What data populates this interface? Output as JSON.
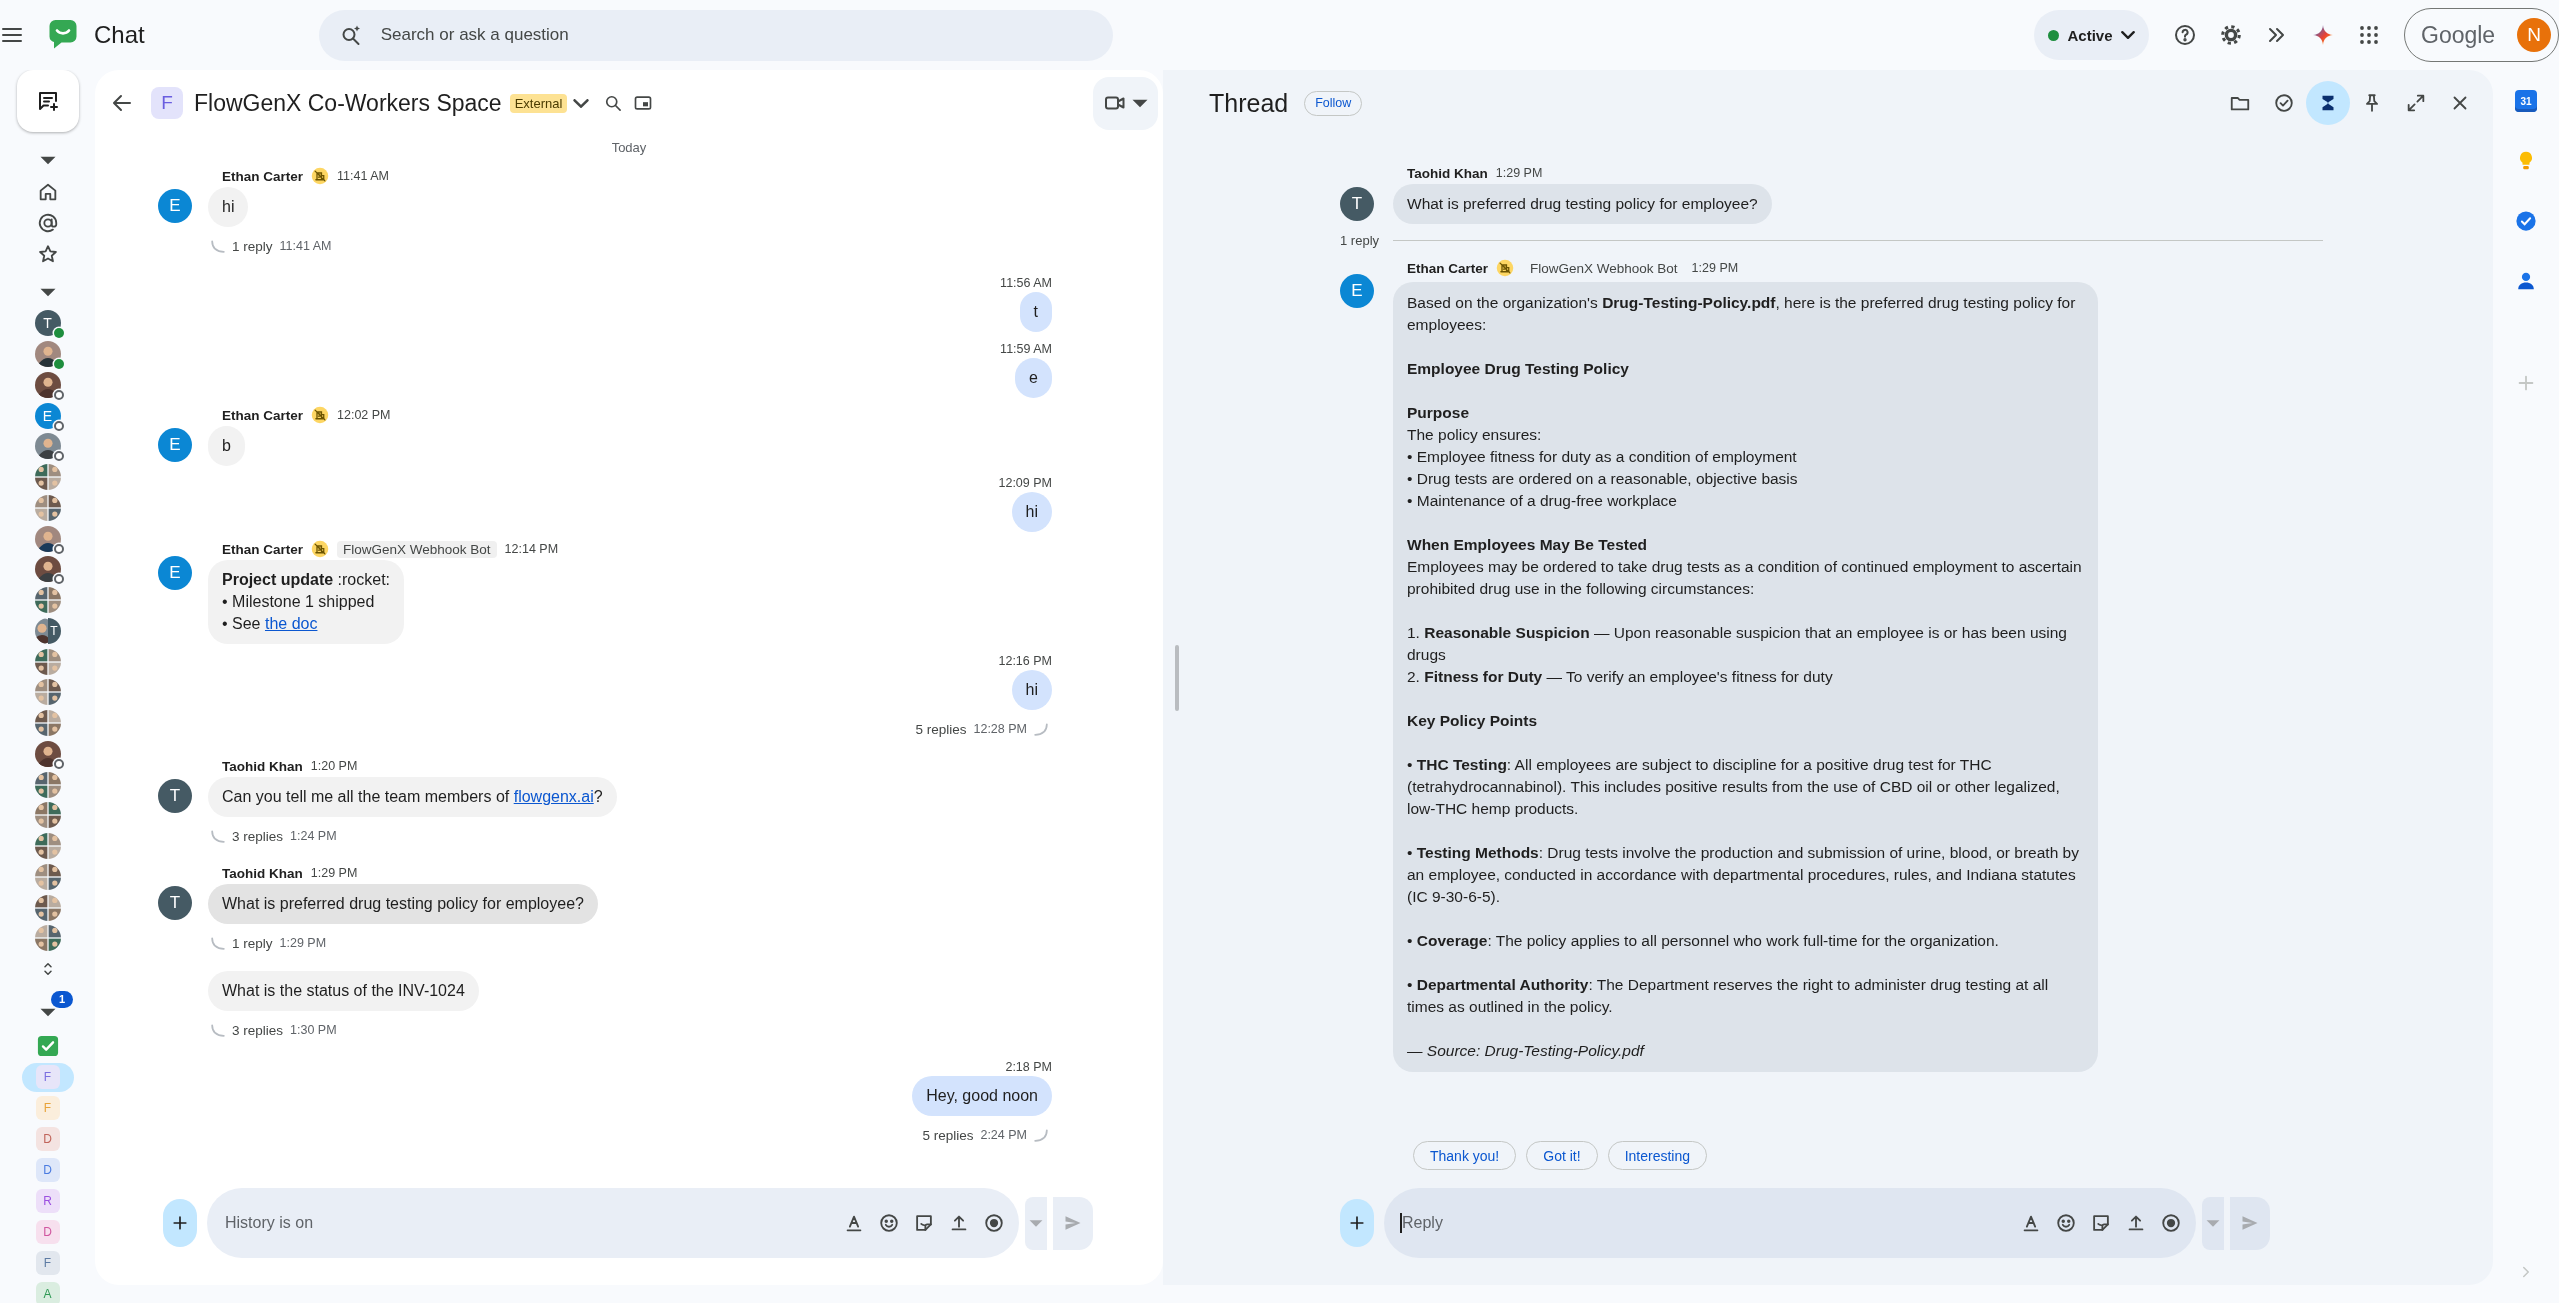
{
  "topbar": {
    "app_title": "Chat",
    "search": {
      "placeholder": "Search or ask a question"
    },
    "status": {
      "label": "Active",
      "available": true
    },
    "account": {
      "brand": "Google",
      "initial": "N"
    }
  },
  "rail": {
    "direct_messages": [
      {
        "kind": "letter",
        "initial": "T",
        "color": "#455a64",
        "online": true
      },
      {
        "kind": "photo",
        "online": true
      },
      {
        "kind": "photo",
        "online": false
      },
      {
        "kind": "letter",
        "initial": "E",
        "color": "#0b87d4",
        "online": false
      },
      {
        "kind": "photo",
        "online": false
      },
      {
        "kind": "group"
      },
      {
        "kind": "group"
      },
      {
        "kind": "photo",
        "online": false
      },
      {
        "kind": "photo",
        "online": false
      },
      {
        "kind": "group"
      },
      {
        "kind": "split",
        "initial": "T",
        "color": "#455a64"
      },
      {
        "kind": "group"
      },
      {
        "kind": "group"
      },
      {
        "kind": "group"
      },
      {
        "kind": "photo",
        "online": false
      },
      {
        "kind": "group"
      },
      {
        "kind": "group"
      },
      {
        "kind": "group"
      },
      {
        "kind": "group"
      },
      {
        "kind": "group"
      },
      {
        "kind": "group"
      }
    ],
    "spaces_badge": "1",
    "spaces": [
      {
        "kind": "check",
        "selected": false
      },
      {
        "kind": "letter",
        "initial": "F",
        "color": "#7b6fe0",
        "selected": true
      },
      {
        "kind": "letter",
        "initial": "F",
        "color": "#e8a33a",
        "selected": false
      },
      {
        "kind": "letter",
        "initial": "D",
        "color": "#c0645a",
        "selected": false
      },
      {
        "kind": "letter",
        "initial": "D",
        "color": "#4a7be0",
        "selected": false
      },
      {
        "kind": "letter",
        "initial": "R",
        "color": "#9b4fe0",
        "selected": false
      },
      {
        "kind": "letter",
        "initial": "D",
        "color": "#d0559f",
        "selected": false
      },
      {
        "kind": "letter",
        "initial": "F",
        "color": "#5d7ba3",
        "selected": false
      },
      {
        "kind": "letter",
        "initial": "A",
        "color": "#2f9a55",
        "selected": false
      }
    ]
  },
  "chat": {
    "header": {
      "initial": "F",
      "title": "FlowGenX Co-Workers Space",
      "badge": "External"
    },
    "date_label": "Today",
    "messages": [
      {
        "outgoing": false,
        "avatar": {
          "initial": "E",
          "color": "#0b87d4"
        },
        "sender": "Ethan Carter",
        "external_user": true,
        "time": "11:41 AM",
        "lines": [
          {
            "text": "hi"
          }
        ],
        "selected": false,
        "replies": "1 reply",
        "reply_time": "11:41 AM"
      },
      {
        "outgoing": true,
        "time": "11:56 AM",
        "lines": [
          {
            "text": "t"
          }
        ],
        "selected": false
      },
      {
        "outgoing": true,
        "time": "11:59 AM",
        "lines": [
          {
            "text": "e"
          }
        ],
        "selected": false
      },
      {
        "outgoing": false,
        "avatar": {
          "initial": "E",
          "color": "#0b87d4"
        },
        "sender": "Ethan Carter",
        "external_user": true,
        "time": "12:02 PM",
        "lines": [
          {
            "text": "b"
          }
        ],
        "selected": false
      },
      {
        "outgoing": true,
        "time": "12:09 PM",
        "lines": [
          {
            "text": "hi"
          }
        ],
        "selected": false
      },
      {
        "outgoing": false,
        "avatar": {
          "initial": "E",
          "color": "#0b87d4"
        },
        "sender": "Ethan Carter",
        "external_user": true,
        "bot_tag": "FlowGenX Webhook Bot",
        "time": "12:14 PM",
        "lines": [
          {
            "text": "**Project update** :rocket:"
          },
          {
            "text": "•  Milestone 1 shipped"
          },
          {
            "text": "•  See ",
            "link": "the doc"
          }
        ],
        "selected": false
      },
      {
        "outgoing": true,
        "time": "12:16 PM",
        "lines": [
          {
            "text": "hi"
          }
        ],
        "selected": false,
        "replies": "5 replies",
        "reply_time": "12:28 PM"
      },
      {
        "outgoing": false,
        "avatar": {
          "initial": "T",
          "color": "#455a64"
        },
        "sender": "Taohid Khan",
        "external_user": false,
        "time": "1:20 PM",
        "lines": [
          {
            "text": "Can you tell me all the team members of ",
            "link": "flowgenx.ai",
            "after": "?"
          }
        ],
        "selected": false,
        "replies": "3 replies",
        "reply_time": "1:24 PM"
      },
      {
        "outgoing": false,
        "avatar": {
          "initial": "T",
          "color": "#455a64"
        },
        "sender": "Taohid Khan",
        "external_user": false,
        "time": "1:29 PM",
        "lines": [
          {
            "text": "What is preferred drug testing policy for employee?"
          }
        ],
        "selected": true,
        "replies": "1 reply",
        "reply_time": "1:29 PM"
      },
      {
        "outgoing": false,
        "lines": [
          {
            "text": "What is the status of the INV-1024"
          }
        ],
        "selected": false,
        "replies": "3 replies",
        "reply_time": "1:30 PM"
      },
      {
        "outgoing": true,
        "time": "2:18 PM",
        "lines": [
          {
            "text": "Hey, good noon"
          }
        ],
        "selected": false,
        "replies": "5 replies",
        "reply_time": "2:24 PM"
      }
    ],
    "composer": {
      "placeholder": "History is on",
      "focused": false
    }
  },
  "thread": {
    "title": "Thread",
    "follow": "Follow",
    "tools": [
      {
        "kind": "files",
        "selected": false
      },
      {
        "kind": "tasks",
        "selected": false
      },
      {
        "kind": "summary",
        "selected": true
      },
      {
        "kind": "pin",
        "selected": false
      },
      {
        "kind": "expand",
        "selected": false
      },
      {
        "kind": "close",
        "selected": false
      }
    ],
    "root": {
      "avatar": {
        "initial": "T",
        "color": "#455a64"
      },
      "sender": "Taohid Khan",
      "time": "1:29 PM",
      "text": "What is preferred drug testing policy for employee?"
    },
    "reply_count": "1 reply",
    "answer": {
      "avatar": {
        "initial": "E",
        "color": "#0b87d4"
      },
      "sender": "Ethan Carter",
      "external_user": true,
      "bot_tag": "FlowGenX Webhook Bot",
      "time": "1:29 PM",
      "lines": [
        {
          "kind": "text",
          "text": "Based on the organization's **Drug-Testing-Policy.pdf**, here is the preferred drug testing policy for employees:"
        },
        {
          "kind": "gap"
        },
        {
          "kind": "heading",
          "text": "Employee Drug Testing Policy"
        },
        {
          "kind": "gap"
        },
        {
          "kind": "heading",
          "text": "Purpose"
        },
        {
          "kind": "text",
          "text": "The policy ensures:"
        },
        {
          "kind": "text",
          "text": "•  Employee fitness for duty as a condition of employment"
        },
        {
          "kind": "text",
          "text": "•  Drug tests are ordered on a reasonable, objective basis"
        },
        {
          "kind": "text",
          "text": "•  Maintenance of a drug-free workplace"
        },
        {
          "kind": "gap"
        },
        {
          "kind": "heading",
          "text": "When Employees May Be Tested"
        },
        {
          "kind": "text",
          "text": "Employees may be ordered to take drug tests as a condition of continued employment to ascertain prohibited drug use in the following circumstances:"
        },
        {
          "kind": "gap"
        },
        {
          "kind": "text",
          "text": "1. **Reasonable Suspicion** — Upon reasonable suspicion that an employee is or has been using drugs"
        },
        {
          "kind": "text",
          "text": "2. **Fitness for Duty** — To verify an employee's fitness for duty"
        },
        {
          "kind": "gap"
        },
        {
          "kind": "heading",
          "text": "Key Policy Points"
        },
        {
          "kind": "gap"
        },
        {
          "kind": "text",
          "text": "•  **THC Testing**: All employees are subject to discipline for a positive drug test for THC (tetrahydrocannabinol). This includes positive results from the use of CBD oil or other legalized, low-THC hemp products."
        },
        {
          "kind": "gap"
        },
        {
          "kind": "text",
          "text": "•  **Testing Methods**: Drug tests involve the production and submission of urine, blood, or breath by an employee, conducted in accordance with departmental procedures, rules, and Indiana statutes (IC 9-30-6-5)."
        },
        {
          "kind": "gap"
        },
        {
          "kind": "text",
          "text": "•  **Coverage**: The policy applies to all personnel who work full-time for the organization."
        },
        {
          "kind": "gap"
        },
        {
          "kind": "text",
          "text": "•  **Departmental Authority**: The Department reserves the right to administer drug testing at all times as outlined in the policy."
        },
        {
          "kind": "gap"
        },
        {
          "kind": "note",
          "text": "— Source: Drug-Testing-Policy.pdf"
        }
      ]
    },
    "quick_replies": [
      "Thank you!",
      "Got it!",
      "Interesting"
    ],
    "composer": {
      "placeholder": "Reply",
      "focused": true
    }
  },
  "side_rail": {
    "calendar_date": "31"
  }
}
